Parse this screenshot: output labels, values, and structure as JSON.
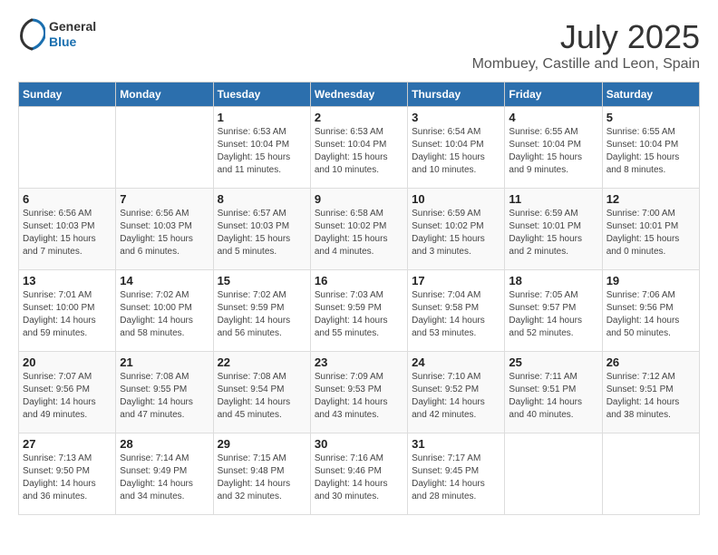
{
  "header": {
    "logo_general": "General",
    "logo_blue": "Blue",
    "month": "July 2025",
    "location": "Mombuey, Castille and Leon, Spain"
  },
  "weekdays": [
    "Sunday",
    "Monday",
    "Tuesday",
    "Wednesday",
    "Thursday",
    "Friday",
    "Saturday"
  ],
  "weeks": [
    [
      {
        "day": "",
        "info": ""
      },
      {
        "day": "",
        "info": ""
      },
      {
        "day": "1",
        "info": "Sunrise: 6:53 AM\nSunset: 10:04 PM\nDaylight: 15 hours\nand 11 minutes."
      },
      {
        "day": "2",
        "info": "Sunrise: 6:53 AM\nSunset: 10:04 PM\nDaylight: 15 hours\nand 10 minutes."
      },
      {
        "day": "3",
        "info": "Sunrise: 6:54 AM\nSunset: 10:04 PM\nDaylight: 15 hours\nand 10 minutes."
      },
      {
        "day": "4",
        "info": "Sunrise: 6:55 AM\nSunset: 10:04 PM\nDaylight: 15 hours\nand 9 minutes."
      },
      {
        "day": "5",
        "info": "Sunrise: 6:55 AM\nSunset: 10:04 PM\nDaylight: 15 hours\nand 8 minutes."
      }
    ],
    [
      {
        "day": "6",
        "info": "Sunrise: 6:56 AM\nSunset: 10:03 PM\nDaylight: 15 hours\nand 7 minutes."
      },
      {
        "day": "7",
        "info": "Sunrise: 6:56 AM\nSunset: 10:03 PM\nDaylight: 15 hours\nand 6 minutes."
      },
      {
        "day": "8",
        "info": "Sunrise: 6:57 AM\nSunset: 10:03 PM\nDaylight: 15 hours\nand 5 minutes."
      },
      {
        "day": "9",
        "info": "Sunrise: 6:58 AM\nSunset: 10:02 PM\nDaylight: 15 hours\nand 4 minutes."
      },
      {
        "day": "10",
        "info": "Sunrise: 6:59 AM\nSunset: 10:02 PM\nDaylight: 15 hours\nand 3 minutes."
      },
      {
        "day": "11",
        "info": "Sunrise: 6:59 AM\nSunset: 10:01 PM\nDaylight: 15 hours\nand 2 minutes."
      },
      {
        "day": "12",
        "info": "Sunrise: 7:00 AM\nSunset: 10:01 PM\nDaylight: 15 hours\nand 0 minutes."
      }
    ],
    [
      {
        "day": "13",
        "info": "Sunrise: 7:01 AM\nSunset: 10:00 PM\nDaylight: 14 hours\nand 59 minutes."
      },
      {
        "day": "14",
        "info": "Sunrise: 7:02 AM\nSunset: 10:00 PM\nDaylight: 14 hours\nand 58 minutes."
      },
      {
        "day": "15",
        "info": "Sunrise: 7:02 AM\nSunset: 9:59 PM\nDaylight: 14 hours\nand 56 minutes."
      },
      {
        "day": "16",
        "info": "Sunrise: 7:03 AM\nSunset: 9:59 PM\nDaylight: 14 hours\nand 55 minutes."
      },
      {
        "day": "17",
        "info": "Sunrise: 7:04 AM\nSunset: 9:58 PM\nDaylight: 14 hours\nand 53 minutes."
      },
      {
        "day": "18",
        "info": "Sunrise: 7:05 AM\nSunset: 9:57 PM\nDaylight: 14 hours\nand 52 minutes."
      },
      {
        "day": "19",
        "info": "Sunrise: 7:06 AM\nSunset: 9:56 PM\nDaylight: 14 hours\nand 50 minutes."
      }
    ],
    [
      {
        "day": "20",
        "info": "Sunrise: 7:07 AM\nSunset: 9:56 PM\nDaylight: 14 hours\nand 49 minutes."
      },
      {
        "day": "21",
        "info": "Sunrise: 7:08 AM\nSunset: 9:55 PM\nDaylight: 14 hours\nand 47 minutes."
      },
      {
        "day": "22",
        "info": "Sunrise: 7:08 AM\nSunset: 9:54 PM\nDaylight: 14 hours\nand 45 minutes."
      },
      {
        "day": "23",
        "info": "Sunrise: 7:09 AM\nSunset: 9:53 PM\nDaylight: 14 hours\nand 43 minutes."
      },
      {
        "day": "24",
        "info": "Sunrise: 7:10 AM\nSunset: 9:52 PM\nDaylight: 14 hours\nand 42 minutes."
      },
      {
        "day": "25",
        "info": "Sunrise: 7:11 AM\nSunset: 9:51 PM\nDaylight: 14 hours\nand 40 minutes."
      },
      {
        "day": "26",
        "info": "Sunrise: 7:12 AM\nSunset: 9:51 PM\nDaylight: 14 hours\nand 38 minutes."
      }
    ],
    [
      {
        "day": "27",
        "info": "Sunrise: 7:13 AM\nSunset: 9:50 PM\nDaylight: 14 hours\nand 36 minutes."
      },
      {
        "day": "28",
        "info": "Sunrise: 7:14 AM\nSunset: 9:49 PM\nDaylight: 14 hours\nand 34 minutes."
      },
      {
        "day": "29",
        "info": "Sunrise: 7:15 AM\nSunset: 9:48 PM\nDaylight: 14 hours\nand 32 minutes."
      },
      {
        "day": "30",
        "info": "Sunrise: 7:16 AM\nSunset: 9:46 PM\nDaylight: 14 hours\nand 30 minutes."
      },
      {
        "day": "31",
        "info": "Sunrise: 7:17 AM\nSunset: 9:45 PM\nDaylight: 14 hours\nand 28 minutes."
      },
      {
        "day": "",
        "info": ""
      },
      {
        "day": "",
        "info": ""
      }
    ]
  ]
}
